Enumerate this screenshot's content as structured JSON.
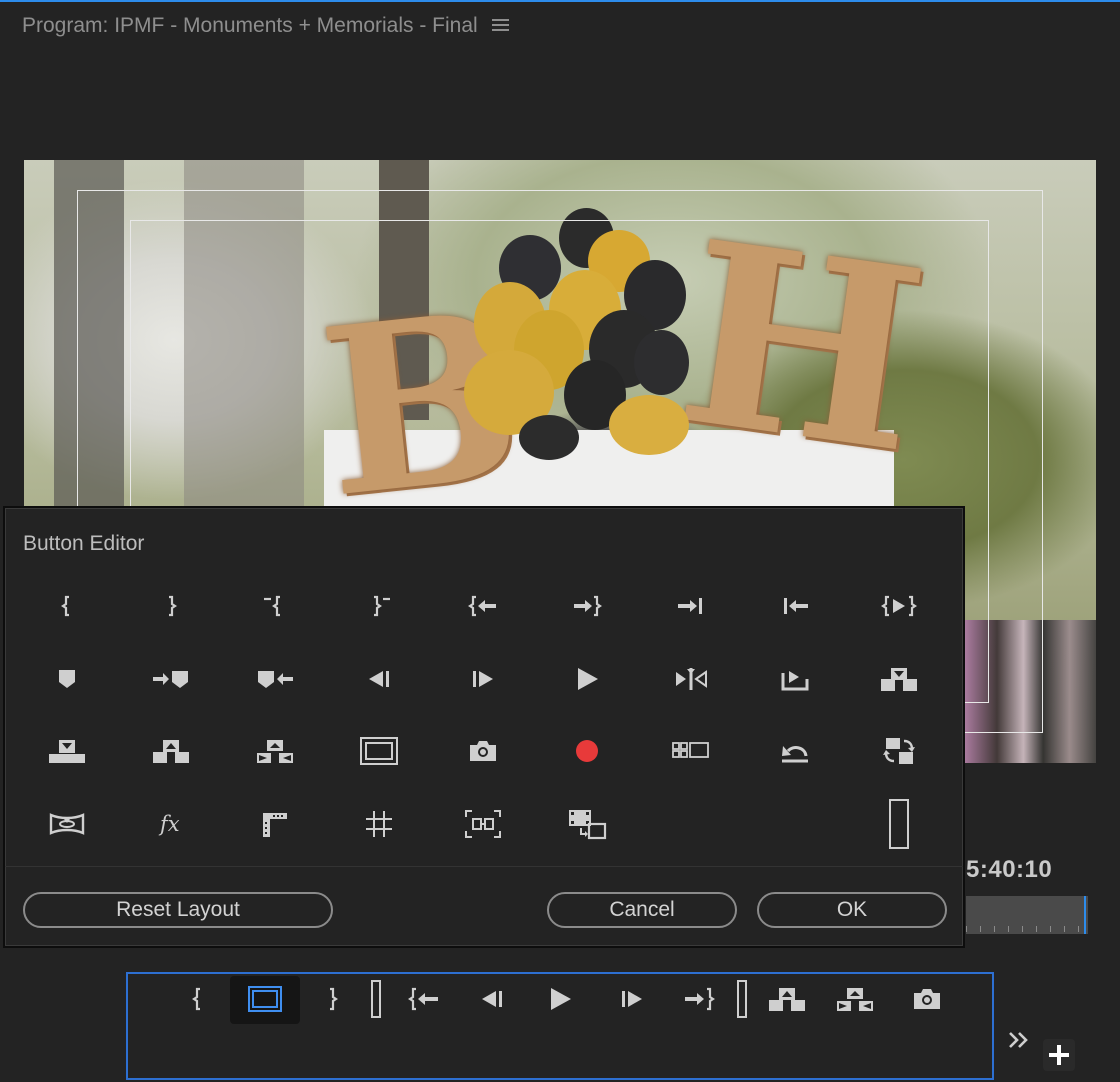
{
  "panel": {
    "title": "Program: IPMF - Monuments + Memorials - Final",
    "menu_icon": "hamburger-menu-icon"
  },
  "program_monitor": {
    "timecode": "5:40:10"
  },
  "button_editor": {
    "title": "Button Editor",
    "icons": [
      "mark-in-icon",
      "mark-out-icon",
      "mark-clip-in-icon",
      "mark-clip-out-icon",
      "go-to-in-icon",
      "go-to-out-icon",
      "go-to-next-edit-icon",
      "go-to-previous-edit-icon",
      "play-in-to-out-icon",
      "add-marker-icon",
      "go-to-next-marker-icon",
      "go-to-previous-marker-icon",
      "step-back-icon",
      "step-forward-icon",
      "play-icon",
      "shuttle-icon",
      "export-frame-icon",
      "insert-icon",
      "overwrite-icon",
      "lift-icon",
      "extract-icon",
      "safe-margins-icon",
      "camera-icon",
      "record-icon",
      "multi-camera-icon",
      "undo-icon",
      "toggle-proxies-icon",
      "vr-video-icon",
      "fx-icon",
      "comparison-view-icon",
      "grid-icon",
      "trim-icon",
      "clip-swap-icon",
      "spacer-icon"
    ],
    "buttons": {
      "reset": "Reset Layout",
      "cancel": "Cancel",
      "ok": "OK"
    }
  },
  "transport_bar": {
    "buttons": [
      "mark-in-icon",
      "safe-margins-icon",
      "mark-out-icon",
      "spacer-icon",
      "go-to-in-icon",
      "step-back-icon",
      "play-icon",
      "step-forward-icon",
      "go-to-out-icon",
      "spacer-icon",
      "lift-icon",
      "extract-icon",
      "camera-icon"
    ],
    "overflow_icon": "double-chevron-right-icon",
    "add_icon": "plus-icon"
  },
  "colors": {
    "accent": "#2d8ceb",
    "record": "#e83a3a",
    "icon": "#cfcfcf"
  }
}
